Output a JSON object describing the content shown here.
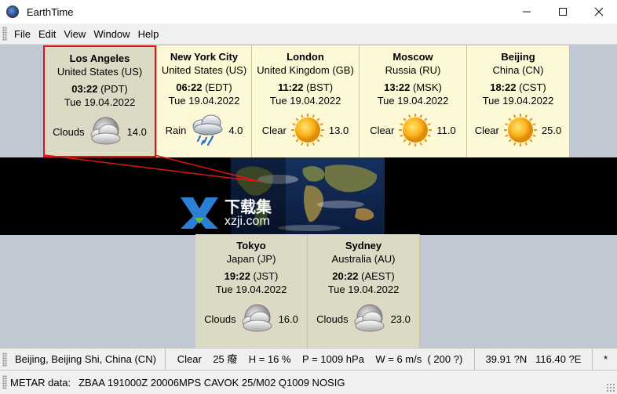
{
  "window": {
    "title": "EarthTime"
  },
  "menu": [
    "File",
    "Edit",
    "View",
    "Window",
    "Help"
  ],
  "cities_top": [
    {
      "name": "Los Angeles",
      "country": "United States (US)",
      "time": "03:22",
      "tz": "(PDT)",
      "date": "Tue 19.04.2022",
      "condition": "Clouds",
      "temp": "14.0",
      "icon": "clouds-night-icon",
      "night": true,
      "selected": true
    },
    {
      "name": "New York City",
      "country": "United States (US)",
      "time": "06:22",
      "tz": "(EDT)",
      "date": "Tue 19.04.2022",
      "condition": "Rain",
      "temp": "4.0",
      "icon": "rain-icon",
      "night": false,
      "selected": false
    },
    {
      "name": "London",
      "country": "United Kingdom (GB)",
      "time": "11:22",
      "tz": "(BST)",
      "date": "Tue 19.04.2022",
      "condition": "Clear",
      "temp": "13.0",
      "icon": "sun-icon",
      "night": false,
      "selected": false
    },
    {
      "name": "Moscow",
      "country": "Russia (RU)",
      "time": "13:22",
      "tz": "(MSK)",
      "date": "Tue 19.04.2022",
      "condition": "Clear",
      "temp": "11.0",
      "icon": "sun-icon",
      "night": false,
      "selected": false
    },
    {
      "name": "Beijing",
      "country": "China (CN)",
      "time": "18:22",
      "tz": "(CST)",
      "date": "Tue 19.04.2022",
      "condition": "Clear",
      "temp": "25.0",
      "icon": "sun-icon",
      "night": false,
      "selected": false
    }
  ],
  "cities_bottom": [
    {
      "name": "Tokyo",
      "country": "Japan (JP)",
      "time": "19:22",
      "tz": "(JST)",
      "date": "Tue 19.04.2022",
      "condition": "Clouds",
      "temp": "16.0",
      "icon": "clouds-night-icon",
      "night": true,
      "selected": false
    },
    {
      "name": "Sydney",
      "country": "Australia (AU)",
      "time": "20:22",
      "tz": "(AEST)",
      "date": "Tue 19.04.2022",
      "condition": "Clouds",
      "temp": "23.0",
      "icon": "clouds-night-icon",
      "night": true,
      "selected": false
    }
  ],
  "status": {
    "location": "Beijing, Beijing Shi, China (CN)",
    "weather": "Clear    25 癈    H = 16 %    P = 1009 hPa    W = 6 m/s  ( 200 ?)",
    "coords": "39.91 ?N   116.40 ?E",
    "extra": "*"
  },
  "metar": {
    "label": "METAR data:",
    "value": "ZBAA 191000Z 20006MPS CAVOK 25/M02 Q1009 NOSIG"
  },
  "watermark": {
    "text": "下载集",
    "sub": "xzji.com"
  },
  "colors": {
    "day_card": "#fdf8d5",
    "night_card": "#dcd9c4",
    "selection": "#e01414",
    "map_bg": "#000000"
  }
}
